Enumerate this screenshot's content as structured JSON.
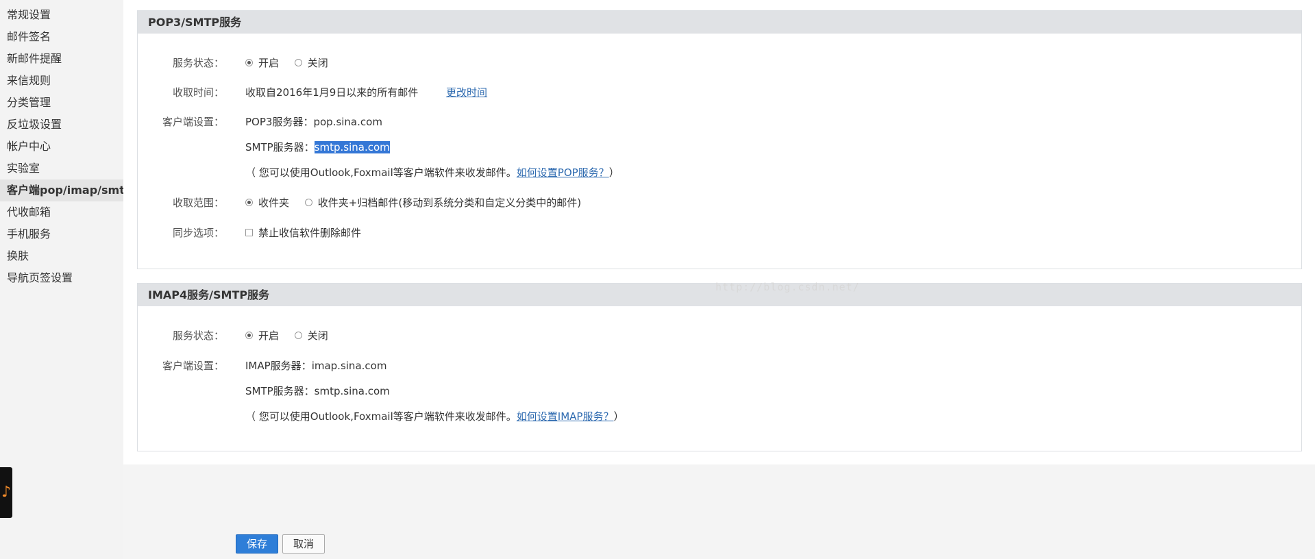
{
  "sidebar": {
    "items": [
      {
        "label": "常规设置"
      },
      {
        "label": "邮件签名"
      },
      {
        "label": "新邮件提醒"
      },
      {
        "label": "来信规则"
      },
      {
        "label": "分类管理"
      },
      {
        "label": "反垃圾设置"
      },
      {
        "label": "帐户中心"
      },
      {
        "label": "实验室"
      },
      {
        "label": "客户端pop/imap/smtp"
      },
      {
        "label": "代收邮箱"
      },
      {
        "label": "手机服务"
      },
      {
        "label": "换肤"
      },
      {
        "label": "导航页签设置"
      }
    ],
    "music_icon": "♪"
  },
  "pop3": {
    "title": "POP3/SMTP服务",
    "status_label": "服务状态：",
    "status_on": "开启",
    "status_off": "关闭",
    "fetch_time_label": "收取时间：",
    "fetch_time_value": "收取自2016年1月9日以来的所有邮件",
    "change_time_link": "更改时间",
    "client_label": "客户端设置：",
    "pop3_server_prefix": "POP3服务器：",
    "pop3_server": "pop.sina.com",
    "smtp_server_prefix": "SMTP服务器：",
    "smtp_server": "smtp.sina.com",
    "note_prefix": "（ 您可以使用Outlook,Foxmail等客户端软件来收发邮件。",
    "note_link": "如何设置POP服务？",
    "note_suffix": "）",
    "range_label": "收取范围：",
    "range_opt1": "收件夹",
    "range_opt2": "收件夹+归档邮件(移动到系统分类和自定义分类中的邮件)",
    "sync_label": "同步选项：",
    "sync_opt": "禁止收信软件删除邮件"
  },
  "imap": {
    "title": "IMAP4服务/SMTP服务",
    "status_label": "服务状态：",
    "status_on": "开启",
    "status_off": "关闭",
    "client_label": "客户端设置：",
    "imap_server_prefix": "IMAP服务器：",
    "imap_server": "imap.sina.com",
    "smtp_server_prefix": "SMTP服务器：",
    "smtp_server": "smtp.sina.com",
    "note_prefix": "（ 您可以使用Outlook,Foxmail等客户端软件来收发邮件。",
    "note_link": "如何设置IMAP服务？",
    "note_suffix": "）"
  },
  "watermark": "http://blog.csdn.net/",
  "footer": {
    "save_label": "保存",
    "cancel_label": "取消"
  }
}
